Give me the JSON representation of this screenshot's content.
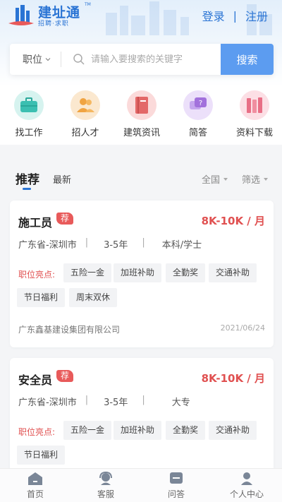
{
  "header": {
    "logo_title": "建址通",
    "logo_sub": "招聘·求职",
    "tm": "TM",
    "login": "登录",
    "separator": "|",
    "register": "注册"
  },
  "search": {
    "position_select": "职位",
    "placeholder": "请输入要搜索的关键字",
    "button": "搜索"
  },
  "categories": [
    {
      "label": "找工作",
      "icon": "briefcase-icon",
      "color": "#3bbfb1"
    },
    {
      "label": "招人才",
      "icon": "people-icon",
      "color": "#f0a442"
    },
    {
      "label": "建筑资讯",
      "icon": "book-icon",
      "color": "#e36868"
    },
    {
      "label": "简答",
      "icon": "chat-icon",
      "color": "#a271dc"
    },
    {
      "label": "资料下载",
      "icon": "books-icon",
      "color": "#e86f86"
    }
  ],
  "tabs": {
    "recommend": "推荐",
    "latest": "最新",
    "region": "全国",
    "filter": "筛选"
  },
  "jobs": [
    {
      "title": "施工员",
      "badge": "荐",
      "salary": "8K-10K / 月",
      "location": "广东省-深圳市",
      "experience": "3-5年",
      "education": "本科/学士",
      "highlight_label": "职位亮点:",
      "tags": [
        "五险一金",
        "加班补助",
        "全勤奖",
        "交通补助",
        "节日福利",
        "周末双休"
      ],
      "company": "广东鑫基建设集团有限公司",
      "date": "2021/06/24"
    },
    {
      "title": "安全员",
      "badge": "荐",
      "salary": "8K-10K / 月",
      "location": "广东省-深圳市",
      "experience": "3-5年",
      "education": "大专",
      "highlight_label": "职位亮点:",
      "tags": [
        "五险一金",
        "加班补助",
        "全勤奖",
        "交通补助",
        "节日福利"
      ]
    }
  ],
  "tabbar": [
    {
      "label": "首页",
      "icon": "home-icon"
    },
    {
      "label": "客服",
      "icon": "customer-service-icon"
    },
    {
      "label": "问答",
      "icon": "qa-icon"
    },
    {
      "label": "个人中心",
      "icon": "profile-icon"
    }
  ],
  "colors": {
    "brand_blue": "#2a74d4",
    "search_button": "#5c9cf0",
    "salary_red": "#e05050",
    "badge_red": "#e85a5a"
  }
}
